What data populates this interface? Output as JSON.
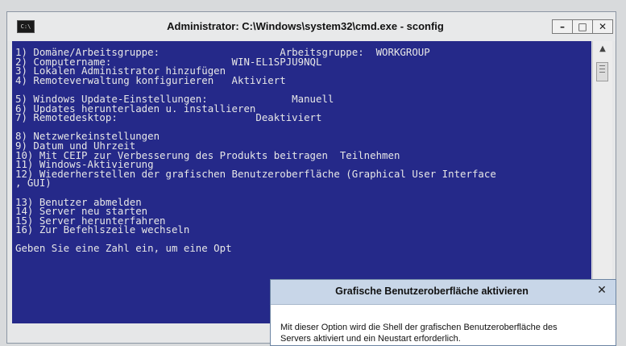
{
  "window": {
    "title": "Administrator: C:\\Windows\\system32\\cmd.exe - sconfig",
    "icon_label": "C:\\",
    "icon": "console-icon",
    "minimize_label": "–",
    "maximize_label": "□",
    "close_label": "✕"
  },
  "console": {
    "lines": [
      "1) Domäne/Arbeitsgruppe:                    Arbeitsgruppe:  WORKGROUP",
      "2) Computername:                    WIN-EL1SPJU9NQL",
      "3) Lokalen Administrator hinzufügen",
      "4) Remoteverwaltung konfigurieren   Aktiviert",
      "",
      "5) Windows Update-Einstellungen:              Manuell",
      "6) Updates herunterladen u. installieren",
      "7) Remotedesktop:                       Deaktiviert",
      "",
      "8) Netzwerkeinstellungen",
      "9) Datum und Uhrzeit",
      "10) Mit CEIP zur Verbesserung des Produkts beitragen  Teilnehmen",
      "11) Windows-Aktivierung",
      "12) Wiederherstellen der grafischen Benutzeroberfläche (Graphical User Interface",
      ", GUI)",
      "",
      "13) Benutzer abmelden",
      "14) Server neu starten",
      "15) Server herunterfahren",
      "16) Zur Befehlszeile wechseln",
      "",
      "Geben Sie eine Zahl ein, um eine Opt"
    ]
  },
  "dialog": {
    "title": "Grafische Benutzeroberfläche aktivieren",
    "close_label": "✕",
    "body_line1": "Mit dieser Option wird die Shell der grafischen Benutzeroberfläche des",
    "body_line2": "Servers aktiviert und ein Neustart erforderlich."
  },
  "colors": {
    "console_background": "#252989",
    "console_text": "#e7e7e7",
    "dialog_titlebar": "#c8d6e8"
  }
}
